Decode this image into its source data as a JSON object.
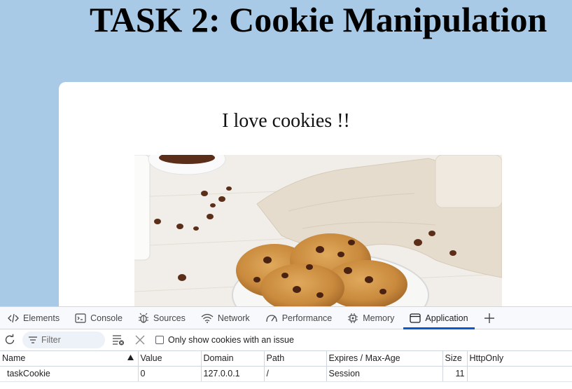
{
  "page": {
    "title": "TASK 2: Cookie Manipulation",
    "card_heading": "I love cookies !!"
  },
  "devtools": {
    "tabs": [
      {
        "label": "Elements",
        "icon": "code-icon"
      },
      {
        "label": "Console",
        "icon": "console-icon"
      },
      {
        "label": "Sources",
        "icon": "bug-icon"
      },
      {
        "label": "Network",
        "icon": "wifi-icon"
      },
      {
        "label": "Performance",
        "icon": "gauge-icon"
      },
      {
        "label": "Memory",
        "icon": "chip-icon"
      },
      {
        "label": "Application",
        "icon": "window-icon"
      }
    ],
    "active_tab": "Application",
    "accent": "#0b57d0",
    "toolbar": {
      "filter_placeholder": "Filter",
      "issue_checkbox_label": "Only show cookies with an issue"
    },
    "table": {
      "columns": [
        "Name",
        "Value",
        "Domain",
        "Path",
        "Expires / Max-Age",
        "Size",
        "HttpOnly"
      ],
      "rows": [
        {
          "name": "taskCookie",
          "value": "0",
          "domain": "127.0.0.1",
          "path": "/",
          "expires": "Session",
          "size": "11",
          "httponly": ""
        }
      ]
    }
  }
}
